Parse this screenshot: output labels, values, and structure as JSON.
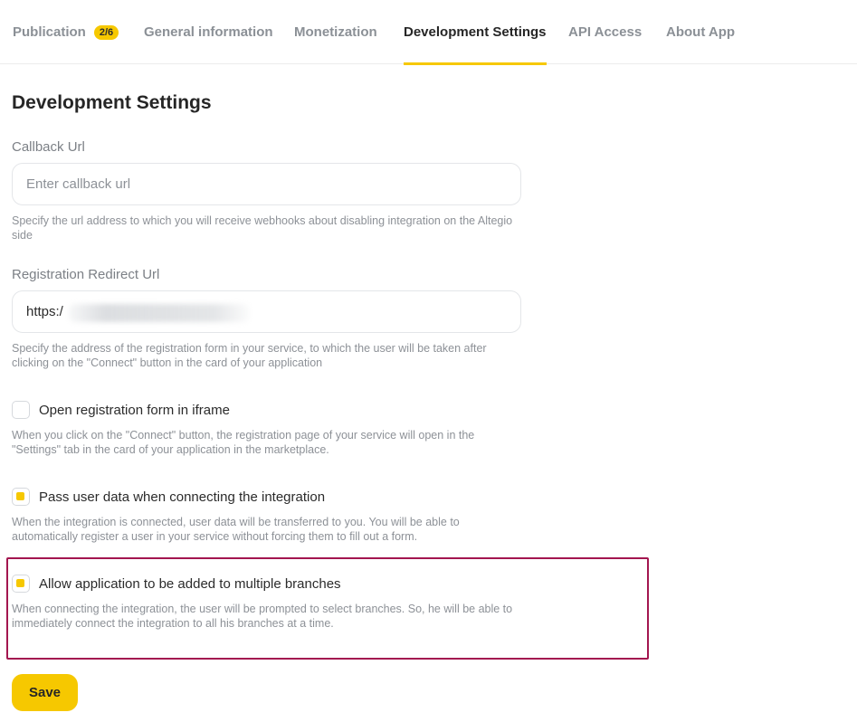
{
  "tabs": [
    {
      "label": "Publication",
      "badge": "2/6"
    },
    {
      "label": "General information"
    },
    {
      "label": "Monetization"
    },
    {
      "label": "Development Settings",
      "active": true
    },
    {
      "label": "API Access"
    },
    {
      "label": "About App"
    }
  ],
  "page_title": "Development Settings",
  "callback": {
    "label": "Callback Url",
    "placeholder": "Enter callback url",
    "value": "",
    "hint": "Specify the url address to which you will receive webhooks about disabling integration on the Altegio side"
  },
  "redirect": {
    "label": "Registration Redirect Url",
    "value": "https:/",
    "hint": "Specify the address of the registration form in your service, to which the user will be taken after clicking on the \"Connect\" button in the card of your application"
  },
  "options": [
    {
      "label": "Open registration form in iframe",
      "checked": false,
      "hint": "When you click on the \"Connect\" button, the registration page of your service will open in the \"Settings\" tab in the card of your application in the marketplace."
    },
    {
      "label": "Pass user data when connecting the integration",
      "checked": true,
      "hint": "When the integration is connected, user data will be transferred to you. You will be able to automatically register a user in your service without forcing them to fill out a form."
    },
    {
      "label": "Allow application to be added to multiple branches",
      "checked": true,
      "hint": "When connecting the integration, the user will be prompted to select branches. So, he will be able to immediately connect the integration to all his branches at a time."
    }
  ],
  "save_label": "Save",
  "colors": {
    "accent": "#f6c800",
    "highlight_border": "#a3164f"
  }
}
